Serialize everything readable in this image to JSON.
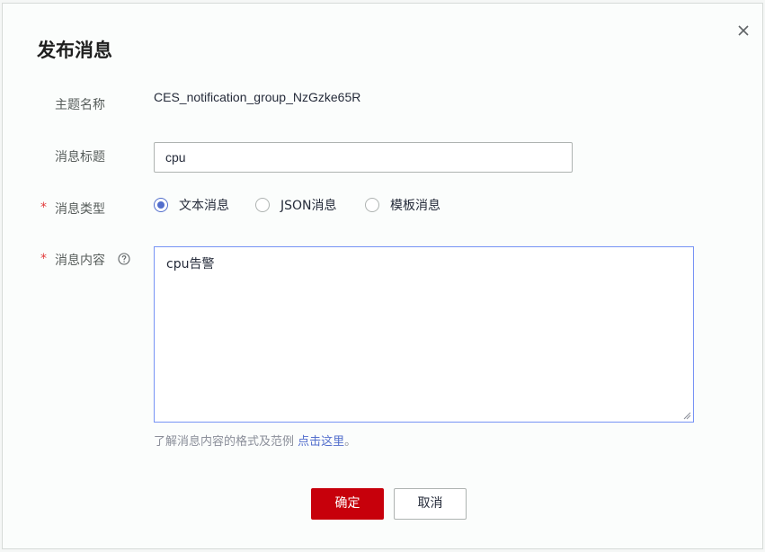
{
  "dialog": {
    "title": "发布消息",
    "close_icon": "close-icon"
  },
  "form": {
    "topic_name": {
      "label": "主题名称",
      "value": "CES_notification_group_NzGzke65R"
    },
    "message_title": {
      "label": "消息标题",
      "value": "cpu"
    },
    "message_type": {
      "label": "消息类型",
      "required_mark": "*",
      "options": [
        {
          "label": "文本消息",
          "checked": true
        },
        {
          "label": "JSON消息",
          "checked": false
        },
        {
          "label": "模板消息",
          "checked": false
        }
      ]
    },
    "message_content": {
      "label": "消息内容",
      "required_mark": "*",
      "help_icon": "question-circle-icon",
      "value": "cpu告警"
    },
    "hint": {
      "text": "了解消息内容的格式及范例 ",
      "link_text": "点击这里",
      "suffix": "。"
    }
  },
  "buttons": {
    "confirm_label": "确定",
    "cancel_label": "取消"
  },
  "colors": {
    "accent": "#526ecc",
    "primary_button": "#c7000b",
    "required": "#e23b3b"
  }
}
